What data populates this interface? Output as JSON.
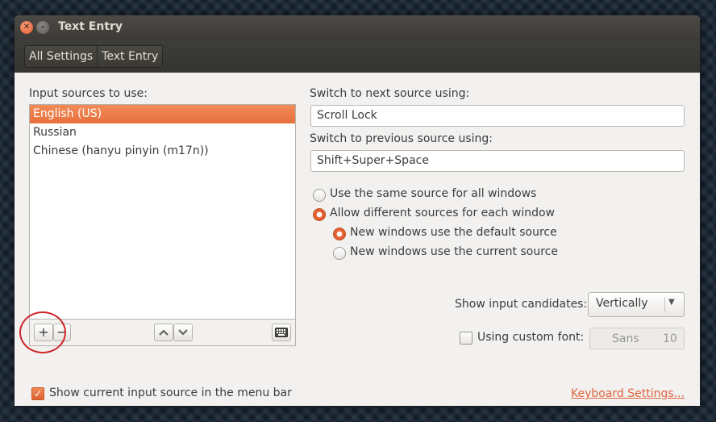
{
  "window": {
    "title": "Text Entry",
    "close_symbol": "✕",
    "minimize_symbol": "–"
  },
  "breadcrumb": {
    "items": [
      {
        "label": "All Settings"
      },
      {
        "label": "Text Entry"
      }
    ]
  },
  "sources": {
    "heading": "Input sources to use:",
    "items": [
      {
        "label": "English (US)",
        "selected": true
      },
      {
        "label": "Russian",
        "selected": false
      },
      {
        "label": "Chinese (hanyu pinyin (m17n))",
        "selected": false
      }
    ],
    "toolbar": {
      "add_symbol": "+",
      "remove_symbol": "−",
      "up_icon": "chevron-up-icon",
      "down_icon": "chevron-down-icon",
      "keyboard_icon": "keyboard-icon"
    }
  },
  "switching": {
    "next_label": "Switch to next source using:",
    "next_value": "Scroll Lock",
    "previous_label": "Switch to previous source using:",
    "previous_value": "Shift+Super+Space",
    "options": [
      {
        "label": "Use the same source for all windows",
        "selected": false
      },
      {
        "label": "Allow different sources for each window",
        "selected": true
      }
    ],
    "suboptions": [
      {
        "label": "New windows use the default source",
        "selected": true
      },
      {
        "label": "New windows use the current source",
        "selected": false
      }
    ]
  },
  "candidates": {
    "label": "Show input candidates:",
    "selected": "Vertically"
  },
  "custom_font": {
    "label": "Using custom font:",
    "checked": false,
    "font_name": "Sans",
    "font_size": "10"
  },
  "footer": {
    "show_source_label": "Show current input source in the menu bar",
    "show_source_checked": true,
    "check_symbol": "✓",
    "keyboard_settings_link": "Keyboard Settings..."
  },
  "colors": {
    "accent": "#e7703c",
    "selection": "#f07746",
    "annotation_circle": "#d0262a"
  }
}
